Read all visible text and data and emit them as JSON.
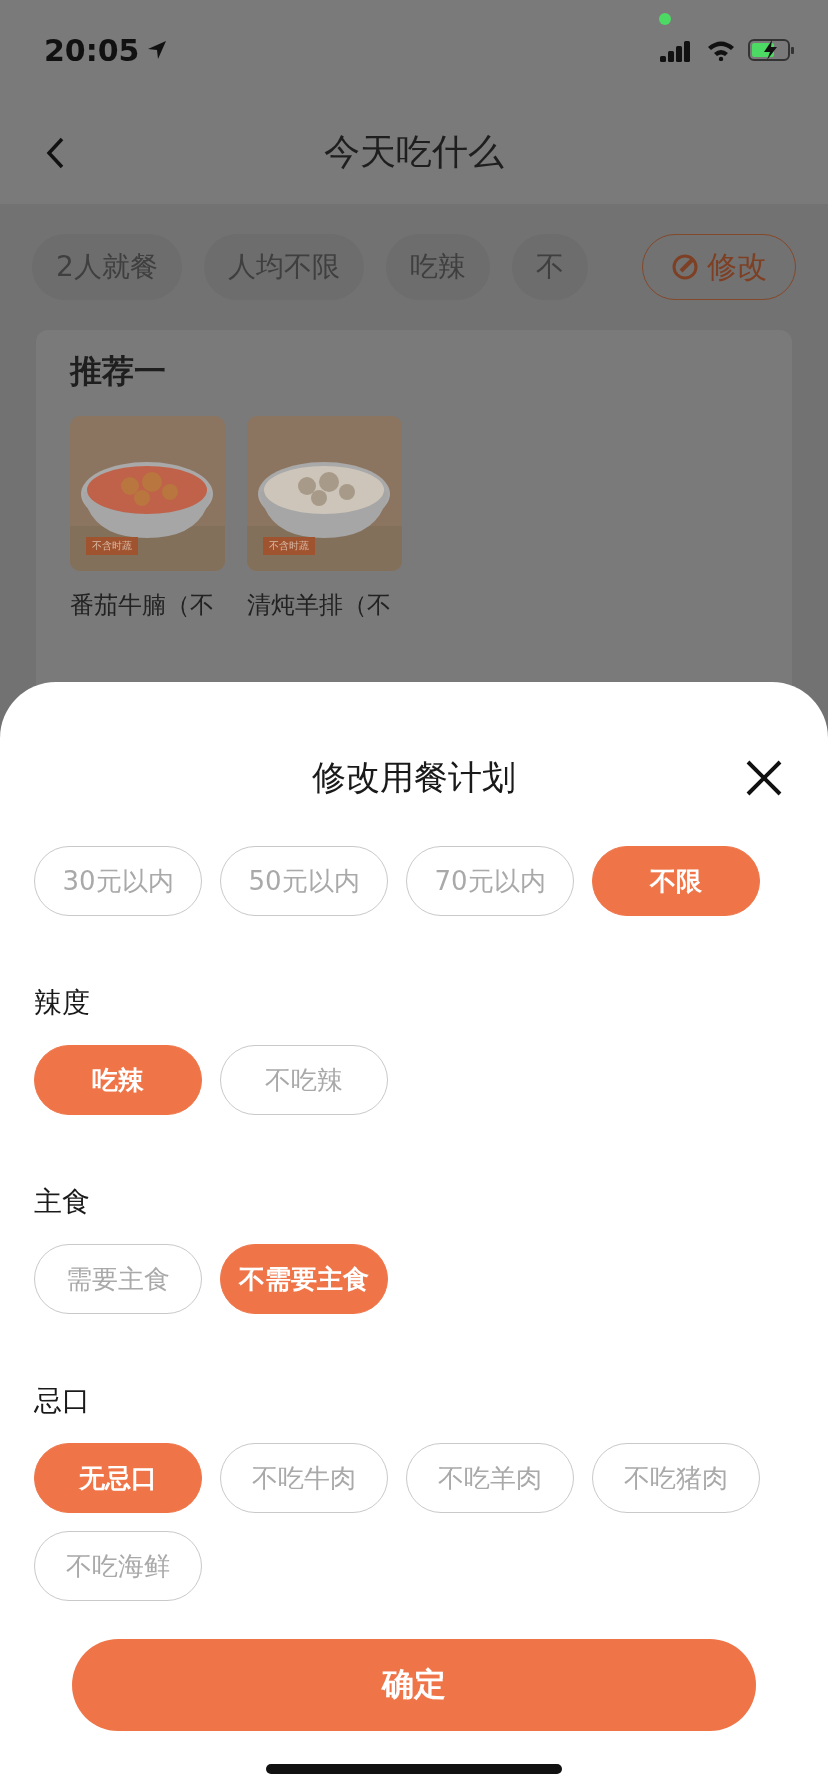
{
  "status_bar": {
    "time": "20:05"
  },
  "nav": {
    "title": "今天吃什么"
  },
  "filters": {
    "chips": [
      "2人就餐",
      "人均不限",
      "吃辣",
      "不"
    ],
    "edit_button": "修改"
  },
  "recommendation": {
    "title": "推荐一",
    "dishes": [
      {
        "name": "番茄牛腩（不",
        "badge": "不含时蔬",
        "kind": "stew"
      },
      {
        "name": "清炖羊排（不",
        "badge": "不含时蔬",
        "kind": "broth"
      }
    ]
  },
  "sheet": {
    "title": "修改用餐计划",
    "groups": [
      {
        "options": [
          {
            "text": "30元以内",
            "selected": false
          },
          {
            "text": "50元以内",
            "selected": false
          },
          {
            "text": "70元以内",
            "selected": false
          },
          {
            "text": "不限",
            "selected": true
          }
        ]
      },
      {
        "label": "辣度",
        "options": [
          {
            "text": "吃辣",
            "selected": true
          },
          {
            "text": "不吃辣",
            "selected": false
          }
        ]
      },
      {
        "label": "主食",
        "options": [
          {
            "text": "需要主食",
            "selected": false
          },
          {
            "text": "不需要主食",
            "selected": true
          }
        ]
      },
      {
        "label": "忌口",
        "options": [
          {
            "text": "无忌口",
            "selected": true
          },
          {
            "text": "不吃牛肉",
            "selected": false
          },
          {
            "text": "不吃羊肉",
            "selected": false
          },
          {
            "text": "不吃猪肉",
            "selected": false
          },
          {
            "text": "不吃海鲜",
            "selected": false
          }
        ]
      }
    ],
    "confirm_button": "确定"
  }
}
